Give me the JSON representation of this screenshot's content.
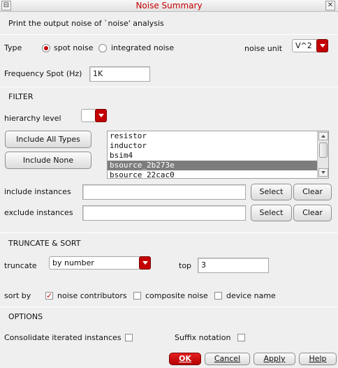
{
  "window": {
    "title": "Noise Summary",
    "description": "Print the output noise of `noise' analysis"
  },
  "type_row": {
    "label": "Type",
    "options": [
      "spot noise",
      "integrated noise"
    ],
    "selected": "spot noise",
    "noise_unit_label": "noise unit",
    "noise_unit_value": "V^2"
  },
  "frequency": {
    "label": "Frequency Spot (Hz)",
    "value": "1K"
  },
  "filter": {
    "section_title": "FILTER",
    "hierarchy_label": "hierarchy level",
    "hierarchy_value": "",
    "include_all_types": "Include All Types",
    "include_none": "Include None",
    "types_list": [
      "resistor",
      "inductor",
      "bsim4",
      "bsource_2b273e",
      "bsource_22cac0"
    ],
    "selected_type": "bsource_2b273e",
    "include_instances_label": "include instances",
    "include_instances_value": "",
    "exclude_instances_label": "exclude instances",
    "exclude_instances_value": "",
    "select_label": "Select",
    "clear_label": "Clear"
  },
  "truncate": {
    "section_title": "TRUNCATE & SORT",
    "truncate_label": "truncate",
    "truncate_value": "by number",
    "top_label": "top",
    "top_value": "3",
    "sort_by_label": "sort by",
    "sort_options": [
      {
        "label": "noise contributors",
        "checked": true
      },
      {
        "label": "composite noise",
        "checked": false
      },
      {
        "label": "device name",
        "checked": false
      }
    ]
  },
  "options": {
    "section_title": "OPTIONS",
    "consolidate_label": "Consolidate iterated instances",
    "consolidate_checked": false,
    "suffix_label": "Suffix notation",
    "suffix_checked": false
  },
  "footer": {
    "ok_label": "OK",
    "cancel_label": "Cancel",
    "apply_label": "Apply",
    "help_label": "Help"
  },
  "colors": {
    "accent": "#c40000",
    "title_text": "#c30000",
    "selection": "#7d7d7d"
  }
}
